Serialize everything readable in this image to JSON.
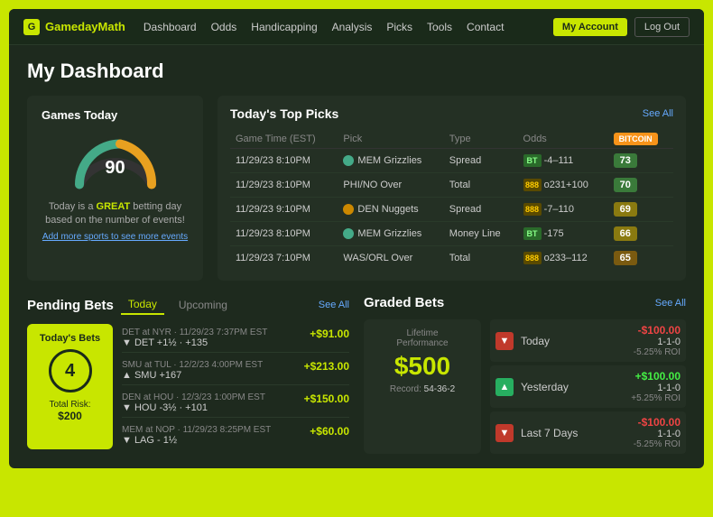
{
  "nav": {
    "logo_icon": "G",
    "logo_text": "GamedayMath",
    "links": [
      "Dashboard",
      "Odds",
      "Handicapping",
      "Analysis",
      "Picks",
      "Tools",
      "Contact"
    ],
    "my_account": "My Account",
    "logout": "Log Out"
  },
  "page": {
    "title": "My Dashboard"
  },
  "games_today": {
    "title": "Games Today",
    "count": "90",
    "description_prefix": "Today is a ",
    "great": "GREAT",
    "description_suffix": " betting day based on the number of events!",
    "add_sports": "Add more sports to see more events"
  },
  "top_picks": {
    "title": "Today's Top Picks",
    "see_all": "See All",
    "bitcoin_label": "BITCOIN",
    "columns": [
      "Game Time (EST)",
      "Pick",
      "Type",
      "Odds",
      ""
    ],
    "rows": [
      {
        "time": "11/29/23 8:10PM",
        "pick": "MEM Grizzlies",
        "flag_color": "#4a8",
        "type": "Spread",
        "book_type": "green",
        "odds": "-4–111",
        "score": 73,
        "score_class": "score-green"
      },
      {
        "time": "11/29/23 8:10PM",
        "pick": "PHI/NO Over",
        "flag_color": "",
        "type": "Total",
        "book_type": "gold",
        "odds": "o231+100",
        "score": 70,
        "score_class": "score-green"
      },
      {
        "time": "11/29/23 9:10PM",
        "pick": "DEN Nuggets",
        "flag_color": "#c80",
        "type": "Spread",
        "book_type": "gold",
        "odds": "-7–110",
        "score": 69,
        "score_class": "score-yellow"
      },
      {
        "time": "11/29/23 8:10PM",
        "pick": "MEM Grizzlies",
        "flag_color": "#4a8",
        "type": "Money Line",
        "book_type": "green",
        "odds": "-175",
        "score": 66,
        "score_class": "score-yellow"
      },
      {
        "time": "11/29/23 7:10PM",
        "pick": "WAS/ORL Over",
        "flag_color": "",
        "type": "Total",
        "book_type": "gold",
        "odds": "o233–112",
        "score": 65,
        "score_class": "score-orange"
      }
    ]
  },
  "pending_bets": {
    "title": "Pending Bets",
    "tab_today": "Today",
    "tab_upcoming": "Upcoming",
    "see_all": "See All",
    "today_bets_label": "Today's Bets",
    "today_bets_count": "4",
    "total_risk_label": "Total Risk:",
    "total_risk_amount": "$200",
    "bets": [
      {
        "meta": "DET at NYR · 11/29/23 7:37PM EST",
        "team": "▼ DET +1½ · +135",
        "direction": "down",
        "amount": "+$91.00"
      },
      {
        "meta": "SMU at TUL · 12/2/23 4:00PM EST",
        "team": "▲ SMU +167",
        "direction": "up",
        "amount": "+$213.00"
      },
      {
        "meta": "DEN at HOU · 12/3/23 1:00PM EST",
        "team": "▼ HOU -3½ · +101",
        "direction": "down",
        "amount": "+$150.00"
      },
      {
        "meta": "MEM at NOP · 11/29/23 8:25PM EST",
        "team": "▼ LAG - 1½",
        "direction": "down",
        "amount": "+$60.00"
      }
    ]
  },
  "graded_bets": {
    "title": "Graded Bets",
    "see_all": "See All",
    "lifetime_label": "Lifetime\nPerformance",
    "lifetime_amount": "$500",
    "record_label": "Record:",
    "record_value": "54-36-2",
    "stats": [
      {
        "label": "Today",
        "direction": "down",
        "amount": "-$100.00",
        "record": "1-1-0",
        "roi": "-5.25% ROI"
      },
      {
        "label": "Yesterday",
        "direction": "up",
        "amount": "+$100.00",
        "record": "1-1-0",
        "roi": "+5.25% ROI"
      },
      {
        "label": "Last 7 Days",
        "direction": "down",
        "amount": "-$100.00",
        "record": "1-1-0",
        "roi": "-5.25% ROI"
      }
    ]
  }
}
